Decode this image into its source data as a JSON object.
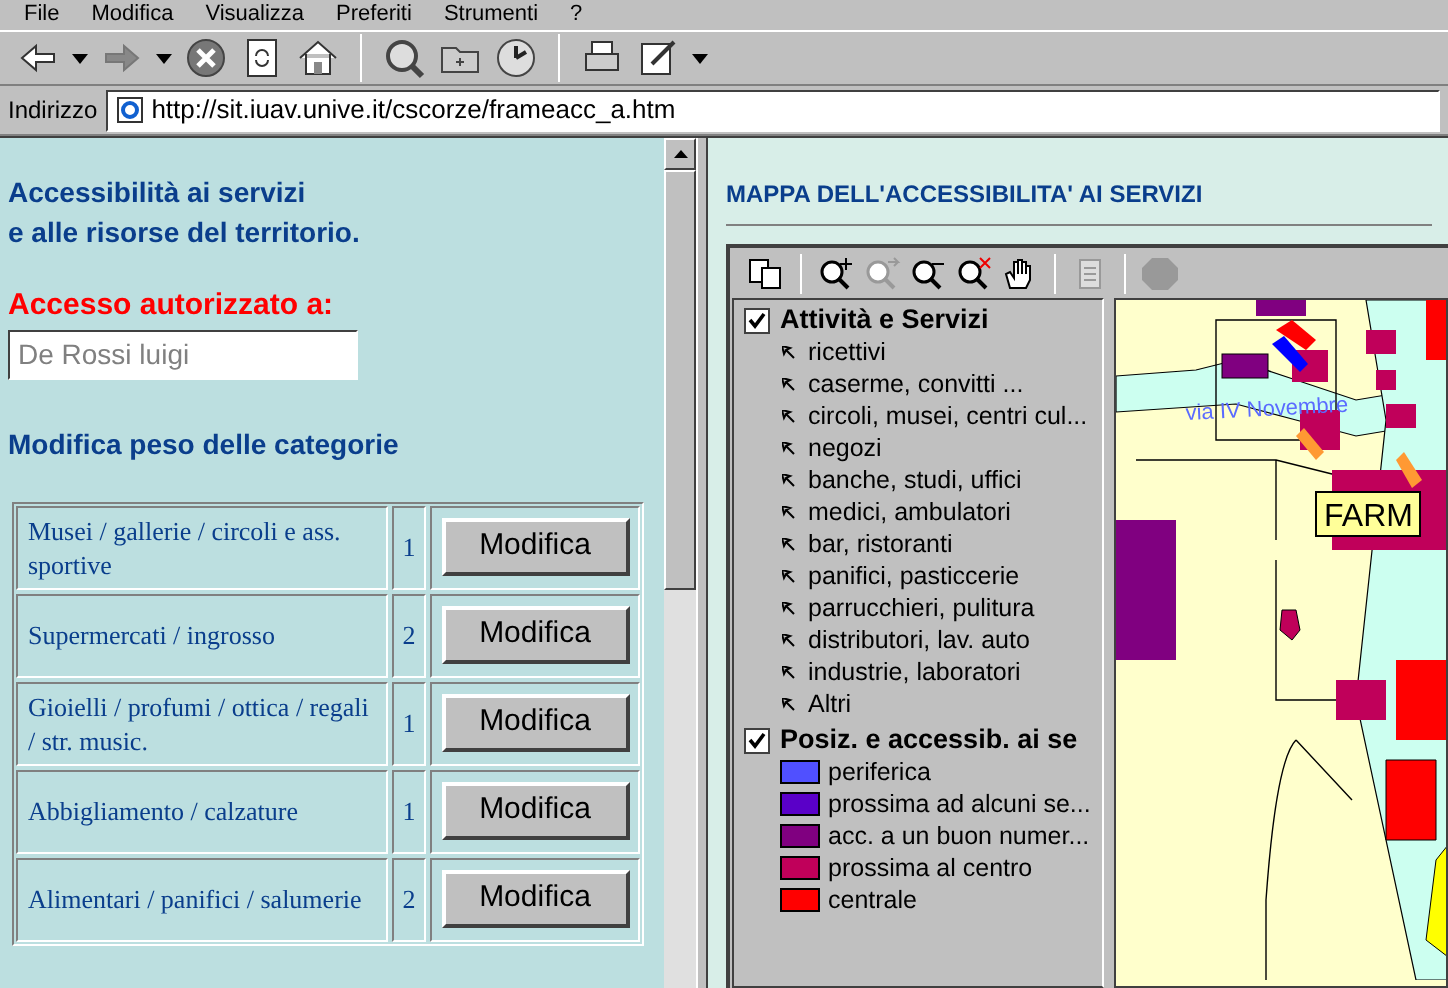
{
  "menu": [
    "File",
    "Modifica",
    "Visualizza",
    "Preferiti",
    "Strumenti",
    "?"
  ],
  "browser_toolbar": [
    {
      "kind": "back"
    },
    {
      "kind": "dropdown"
    },
    {
      "kind": "forward"
    },
    {
      "kind": "dropdown"
    },
    {
      "kind": "stop"
    },
    {
      "kind": "refresh"
    },
    {
      "kind": "home"
    },
    {
      "kind": "sep"
    },
    {
      "kind": "search"
    },
    {
      "kind": "favorites"
    },
    {
      "kind": "history"
    },
    {
      "kind": "sep"
    },
    {
      "kind": "print"
    },
    {
      "kind": "edit"
    },
    {
      "kind": "dropdown"
    }
  ],
  "address_bar": {
    "label": "Indirizzo",
    "value": "http://sit.iuav.unive.it/cscorze/frameacc_a.htm"
  },
  "left_frame": {
    "title_lines": [
      "Accessibilità ai servizi",
      "e alle risorse del territorio."
    ],
    "access_label": "Accesso autorizzato a:",
    "user_field": {
      "value": "De Rossi luigi"
    },
    "section_title": "Modifica peso delle categorie",
    "rows": [
      {
        "category": "Musei / gallerie / circoli e ass. sportive",
        "weight": "1",
        "button": "Modifica"
      },
      {
        "category": "Supermercati / ingrosso",
        "weight": "2",
        "button": "Modifica"
      },
      {
        "category": "Gioielli / profumi / ottica / regali / str. music.",
        "weight": "1",
        "button": "Modifica"
      },
      {
        "category": "Abbigliamento / calzature",
        "weight": "1",
        "button": "Modifica"
      },
      {
        "category": "Alimentari / panifici / salumerie",
        "weight": "2",
        "button": "Modifica"
      }
    ]
  },
  "right_frame": {
    "title": "MAPPA DELL'ACCESSIBILITA' AI SERVIZI",
    "map_toolbar": [
      {
        "kind": "copy",
        "disabled": false
      },
      {
        "kind": "sep"
      },
      {
        "kind": "zoom-in",
        "disabled": false
      },
      {
        "kind": "zoom-prev",
        "disabled": true
      },
      {
        "kind": "zoom-out",
        "disabled": false
      },
      {
        "kind": "zoom-full",
        "disabled": false
      },
      {
        "kind": "pan",
        "disabled": false
      },
      {
        "kind": "sep"
      },
      {
        "kind": "document",
        "disabled": true
      },
      {
        "kind": "sep"
      },
      {
        "kind": "stop",
        "disabled": true
      }
    ],
    "legend": [
      {
        "label": "Attività e Servizi",
        "checked": true,
        "kind": "points",
        "items": [
          {
            "label": "ricettivi"
          },
          {
            "label": "caserme, convitti ..."
          },
          {
            "label": "circoli, musei, centri cul..."
          },
          {
            "label": "negozi"
          },
          {
            "label": "banche, studi, uffici"
          },
          {
            "label": "medici, ambulatori"
          },
          {
            "label": "bar, ristoranti"
          },
          {
            "label": "panifici, pasticcerie"
          },
          {
            "label": "parrucchieri, pulitura"
          },
          {
            "label": "distributori, lav. auto"
          },
          {
            "label": "industrie, laboratori"
          },
          {
            "label": "Altri"
          }
        ]
      },
      {
        "label": "Posiz. e accessib. ai se",
        "checked": true,
        "kind": "classes",
        "items": [
          {
            "label": "periferica",
            "color": "#5050ff"
          },
          {
            "label": "prossima ad alcuni se...",
            "color": "#5a00c8"
          },
          {
            "label": "acc. a un buon numer...",
            "color": "#800080"
          },
          {
            "label": "prossima al centro",
            "color": "#c0005a"
          },
          {
            "label": "centrale",
            "color": "#ff0000"
          }
        ]
      }
    ],
    "map_labels": {
      "street": "via IV Novembre",
      "place": "FARM"
    }
  }
}
